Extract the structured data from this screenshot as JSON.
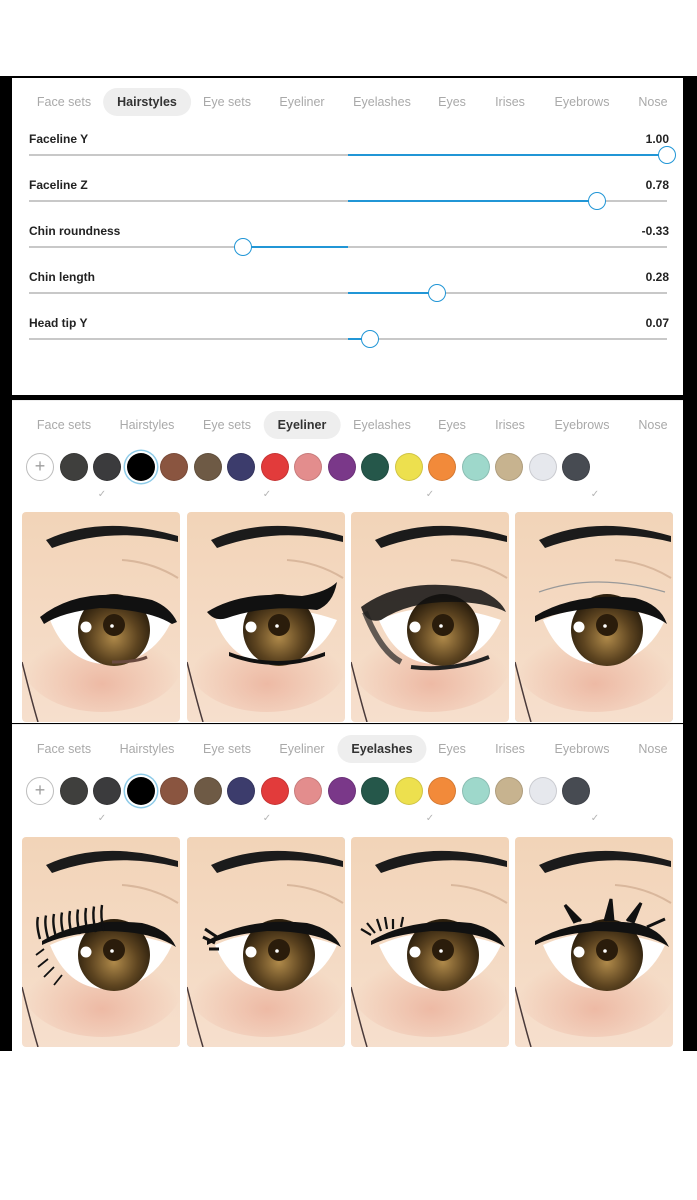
{
  "tabs": [
    "Face sets",
    "Hairstyles",
    "Eye sets",
    "Eyeliner",
    "Eyelashes",
    "Eyes",
    "Irises",
    "Eyebrows",
    "Nose"
  ],
  "panel1": {
    "active_tab": "Hairstyles",
    "sliders": [
      {
        "label": "Faceline Y",
        "value_text": "1.00",
        "value": 1.0
      },
      {
        "label": "Faceline Z",
        "value_text": "0.78",
        "value": 0.78
      },
      {
        "label": "Chin roundness",
        "value_text": "-0.33",
        "value": -0.33
      },
      {
        "label": "Chin length",
        "value_text": "0.28",
        "value": 0.28
      },
      {
        "label": "Head tip Y",
        "value_text": "0.07",
        "value": 0.07
      }
    ]
  },
  "panel2": {
    "active_tab": "Eyeliner",
    "selected_color": "#000000",
    "selected_card": 3,
    "checked_cards": 4
  },
  "panel3": {
    "active_tab": "Eyelashes",
    "selected_color": "#000000",
    "selected_card": 1,
    "checked_cards": 4
  },
  "colors": [
    "#3f3f3d",
    "#3b3b3d",
    "#000000",
    "#8a5540",
    "#6e5a45",
    "#3c3c6c",
    "#e23b3b",
    "#e38d8d",
    "#7a3889",
    "#25574a",
    "#ede04e",
    "#f28a3a",
    "#9ed8cb",
    "#c7b38f",
    "#e6e8ed",
    "#474b52"
  ],
  "add_button_label": "+",
  "check_mark": "✓"
}
